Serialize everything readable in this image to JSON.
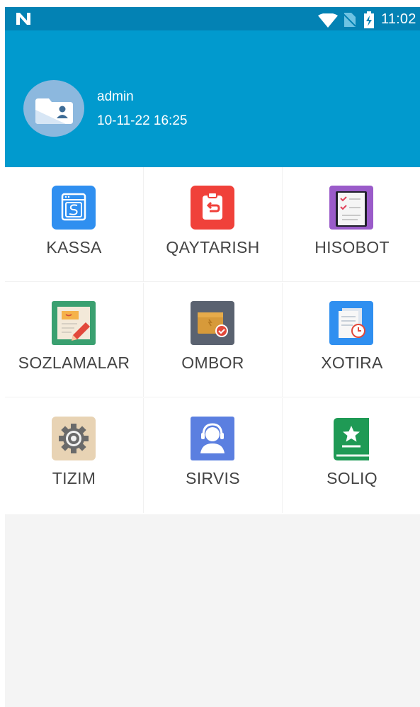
{
  "status_bar": {
    "time": "11:02",
    "icons": [
      "n-notification-icon",
      "wifi-icon",
      "no-sim-icon",
      "battery-charging-icon"
    ]
  },
  "user": {
    "name": "admin",
    "datetime": "10-11-22 16:25",
    "avatar_icon": "user-folder-icon"
  },
  "menu": [
    {
      "label": "KASSA",
      "icon": "cash-register-icon",
      "color": "#2f8ff0"
    },
    {
      "label": "QAYTARISH",
      "icon": "return-icon",
      "color": "#f0413a"
    },
    {
      "label": "HISOBOT",
      "icon": "report-clipboard-icon",
      "color": "#9a5bc9"
    },
    {
      "label": "SOZLAMALAR",
      "icon": "settings-edit-icon",
      "color": "#3aa070"
    },
    {
      "label": "OMBOR",
      "icon": "warehouse-box-icon",
      "color": "#5a6270"
    },
    {
      "label": "XOTIRA",
      "icon": "memory-document-icon",
      "color": "#2f8ff0"
    },
    {
      "label": "TIZIM",
      "icon": "system-gear-icon",
      "color": "#e8d3b4"
    },
    {
      "label": "SIRVIS",
      "icon": "service-support-icon",
      "color": "#5b7fe0"
    },
    {
      "label": "SOLIQ",
      "icon": "tax-book-icon",
      "color": "#1f9a55"
    }
  ],
  "colors": {
    "status_bar": "#0382b4",
    "header": "#019ace",
    "footer": "#f4f4f4"
  }
}
